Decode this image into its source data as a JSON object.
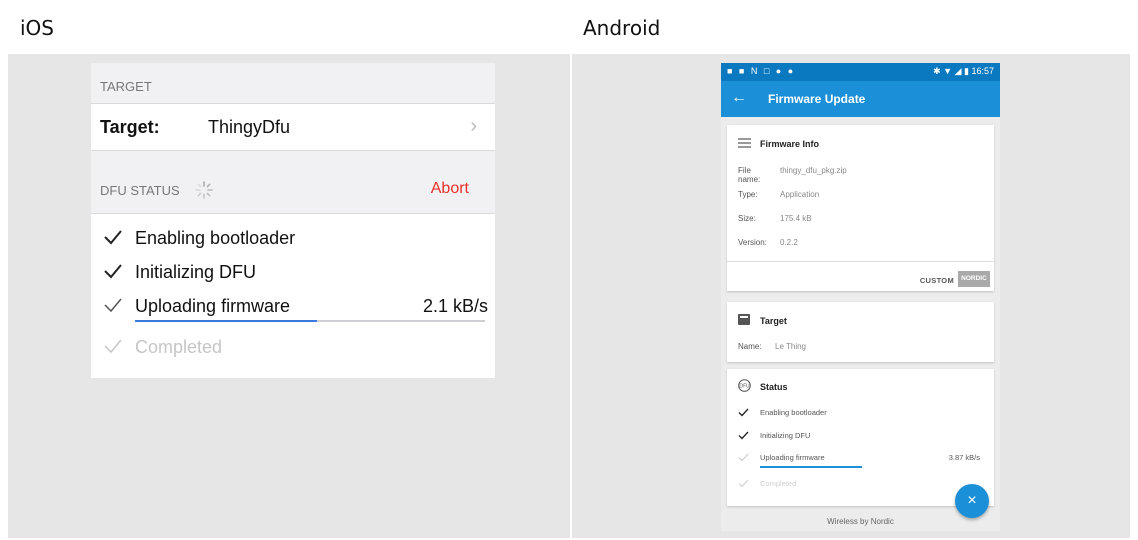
{
  "headings": {
    "ios": "iOS",
    "android": "Android"
  },
  "colors": {
    "ios_abort": "#e8312b",
    "ios_progress": "#3c7ae0",
    "android_primary": "#1b8fd8",
    "android_statusbar": "#0b79bf"
  },
  "ios": {
    "target_section": "TARGET",
    "target_label": "Target:",
    "target_value": "ThingyDfu",
    "chevron_icon": "chevron-right-icon",
    "status_section": "DFU STATUS",
    "spinner_icon": "activity-spinner-icon",
    "abort_label": "Abort",
    "steps": [
      {
        "label": "Enabling bootloader",
        "state": "done"
      },
      {
        "label": "Initializing DFU",
        "state": "done"
      },
      {
        "label": "Uploading firmware",
        "state": "current",
        "rate": "2.1 kB/s"
      },
      {
        "label": "Completed",
        "state": "pending"
      }
    ],
    "upload_progress": 0.52
  },
  "android": {
    "status_time": "16:57",
    "app_title": "Firmware Update",
    "firmware_info": {
      "title": "Firmware Info",
      "icon": "list-icon",
      "rows": [
        {
          "key": "File name:",
          "value": "thingy_dfu_pkg.zip"
        },
        {
          "key": "Type:",
          "value": "Application"
        },
        {
          "key": "Size:",
          "value": "175.4 kB"
        },
        {
          "key": "Version:",
          "value": "0.2.2"
        }
      ],
      "custom_label": "CUSTOM",
      "nordic_label": "NORDIC"
    },
    "target": {
      "title": "Target",
      "icon": "device-icon",
      "rows": [
        {
          "key": "Name:",
          "value": "Le Thing"
        }
      ]
    },
    "status": {
      "title": "Status",
      "icon": "dfu-status-icon",
      "steps": [
        {
          "label": "Enabling bootloader",
          "state": "done"
        },
        {
          "label": "Initializing DFU",
          "state": "done"
        },
        {
          "label": "Uploading firmware",
          "state": "current",
          "rate": "3.87 kB/s"
        },
        {
          "label": "Completed",
          "state": "pending"
        }
      ],
      "upload_progress": 1.0
    },
    "fab_icon": "close-icon",
    "fab_label": "×",
    "footer": "Wireless by Nordic"
  }
}
